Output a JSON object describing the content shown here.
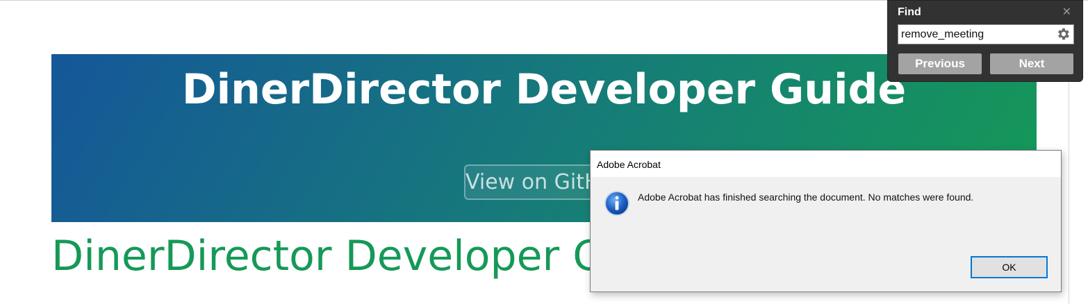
{
  "document": {
    "hero_title": "DinerDirector Developer Guide",
    "hero_button_label": "View on GitHub",
    "page_heading": "DinerDirector Developer Guide"
  },
  "find_panel": {
    "title": "Find",
    "close_icon": "close-icon",
    "query": "remove_meeting",
    "settings_icon": "gear-icon",
    "previous_label": "Previous",
    "next_label": "Next"
  },
  "dialog": {
    "title": "Adobe Acrobat",
    "icon": "info-icon",
    "message": "Adobe Acrobat has finished searching the document. No matches were found.",
    "ok_label": "OK"
  },
  "colors": {
    "hero_gradient_start": "#155799",
    "hero_gradient_end": "#159957",
    "heading_green": "#159957",
    "find_panel_bg": "#323232",
    "find_button_bg": "#a3a3a3",
    "dialog_bg": "#f0f0f0",
    "focus_blue": "#0078d7"
  }
}
